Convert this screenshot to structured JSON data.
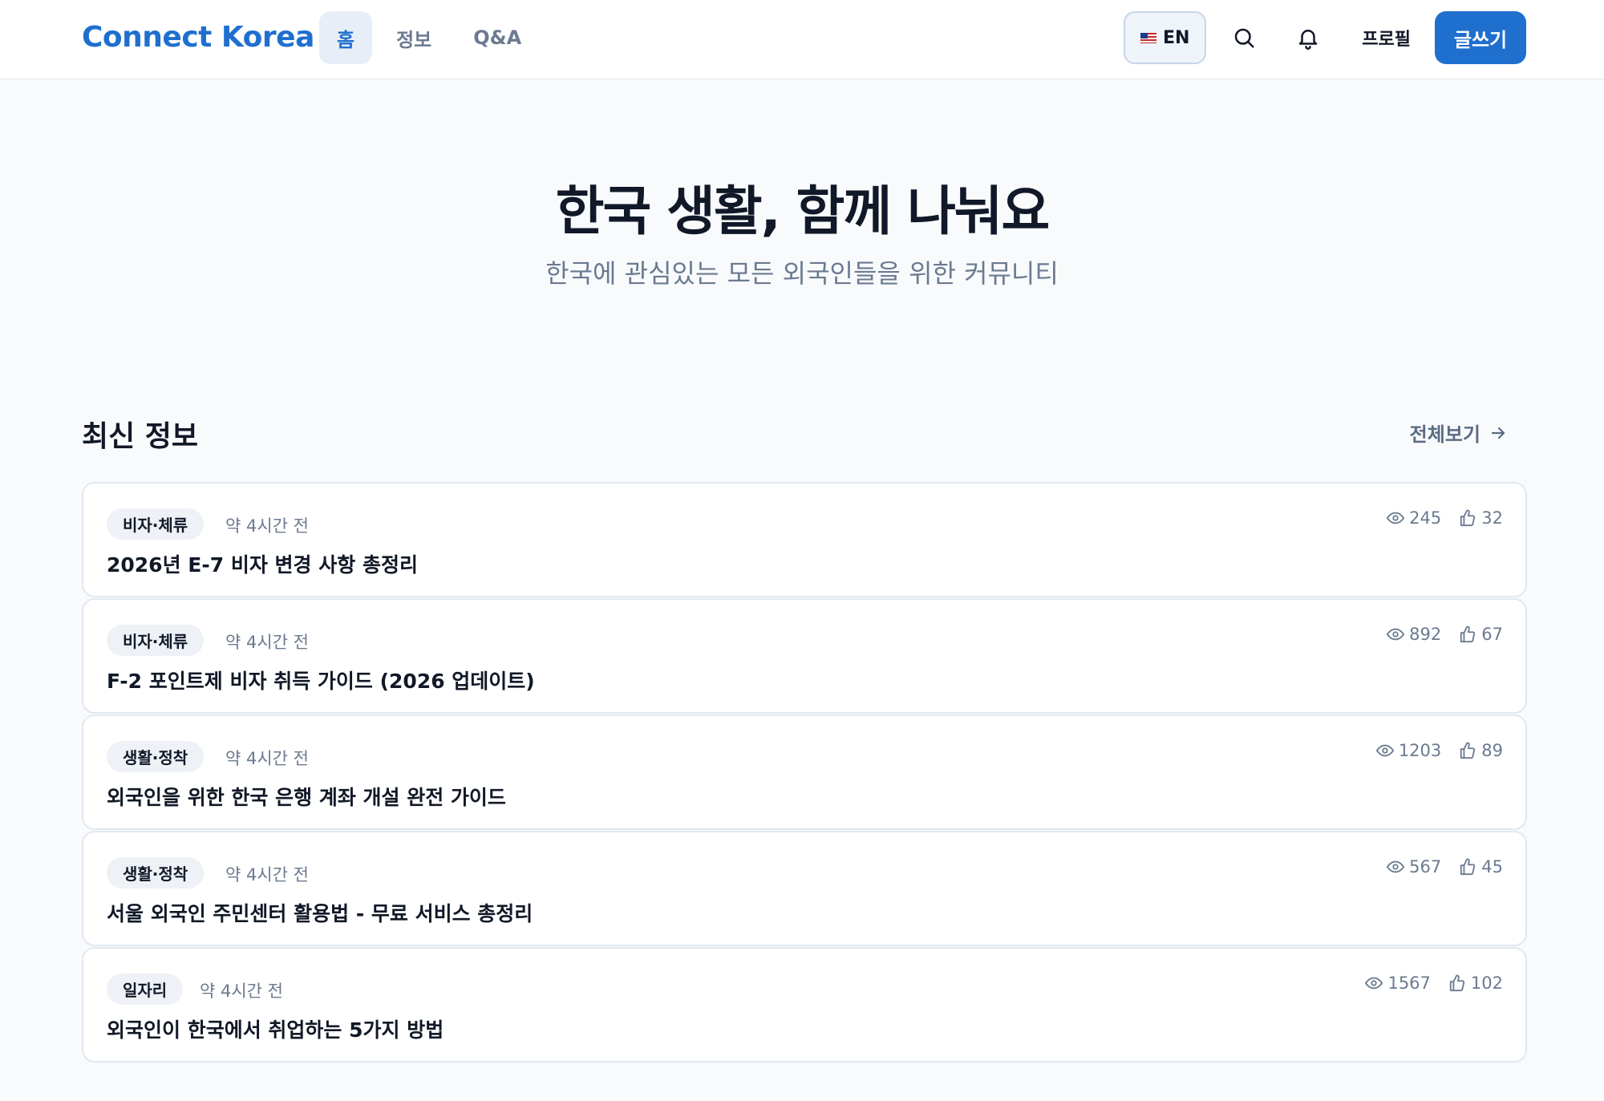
{
  "header": {
    "logo": "Connect Korea",
    "nav": [
      {
        "label": "홈",
        "active": true
      },
      {
        "label": "정보",
        "active": false
      },
      {
        "label": "Q&A",
        "active": false
      }
    ],
    "language": "EN",
    "profile_label": "프로필",
    "write_label": "글쓰기"
  },
  "hero": {
    "title": "한국 생활, 함께 나눠요",
    "subtitle": "한국에 관심있는 모든 외국인들을 위한 커뮤니티"
  },
  "latest": {
    "title": "최신 정보",
    "view_all": "전체보기",
    "posts": [
      {
        "category": "비자·체류",
        "time": "약 4시간 전",
        "title": "2026년 E-7 비자 변경 사항 총정리",
        "views": "245",
        "likes": "32"
      },
      {
        "category": "비자·체류",
        "time": "약 4시간 전",
        "title": "F-2 포인트제 비자 취득 가이드 (2026 업데이트)",
        "views": "892",
        "likes": "67"
      },
      {
        "category": "생활·정착",
        "time": "약 4시간 전",
        "title": "외국인을 위한 한국 은행 계좌 개설 완전 가이드",
        "views": "1203",
        "likes": "89"
      },
      {
        "category": "생활·정착",
        "time": "약 4시간 전",
        "title": "서울 외국인 주민센터 활용법 - 무료 서비스 총정리",
        "views": "567",
        "likes": "45"
      },
      {
        "category": "일자리",
        "time": "약 4시간 전",
        "title": "외국인이 한국에서 취업하는 5가지 방법",
        "views": "1567",
        "likes": "102"
      }
    ]
  },
  "colors": {
    "accent": "#1f6fcf",
    "muted": "#6b7a90",
    "background": "#f8fafc"
  }
}
